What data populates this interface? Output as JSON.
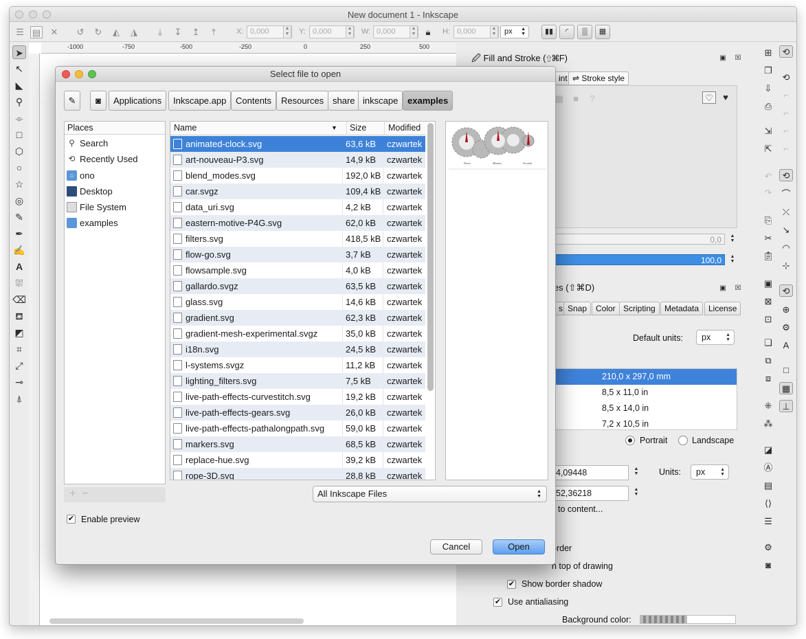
{
  "window": {
    "title": "New document 1 - Inkscape"
  },
  "toolbar": {
    "x_label": "X:",
    "x_value": "0,000",
    "y_label": "Y:",
    "y_value": "0,000",
    "w_label": "W:",
    "w_value": "0,000",
    "h_label": "H:",
    "h_value": "0,000",
    "units": "px"
  },
  "ruler": {
    "ticks": [
      "-1000",
      "-750",
      "-500",
      "-250",
      "0",
      "250",
      "500"
    ]
  },
  "fill_stroke": {
    "title": "Fill and Stroke (⇧⌘F)",
    "tabs": [
      "int",
      "Stroke style"
    ],
    "blur_value": "0,0",
    "opacity_value": "100,0"
  },
  "doc_props": {
    "title": "ies (⇧⌘D)",
    "tabs": [
      "s",
      "Snap",
      "Color",
      "Scripting",
      "Metadata",
      "License"
    ],
    "default_units_label": "Default units:",
    "default_units": "px",
    "paper_sizes": [
      "210,0 x 297,0 mm",
      "8,5 x 11,0 in",
      "8,5 x 14,0 in",
      "7,2 x 10,5 in"
    ],
    "portrait_label": "Portrait",
    "landscape_label": "Landscape",
    "width_value": "4,09448",
    "height_value": "52,36218",
    "units_label": "Units:",
    "units": "px",
    "resize_label": "to content...",
    "border_label": "order",
    "border_top_label": "n top of drawing",
    "border_shadow_label": "Show border shadow",
    "antialiasing_label": "Use antialiasing",
    "bg_color_label": "Background color:"
  },
  "dialog": {
    "title": "Select file to open",
    "path": [
      "Applications",
      "Inkscape.app",
      "Contents",
      "Resources",
      "share",
      "inkscape",
      "examples"
    ],
    "places_header": "Places",
    "places": [
      {
        "label": "Search",
        "icon": "search-icon"
      },
      {
        "label": "Recently Used",
        "icon": "clock-icon"
      },
      {
        "label": "ono",
        "icon": "home-folder-icon"
      },
      {
        "label": "Desktop",
        "icon": "desktop-icon"
      },
      {
        "label": "File System",
        "icon": "drive-icon"
      },
      {
        "label": "examples",
        "icon": "folder-icon"
      }
    ],
    "columns": {
      "name": "Name",
      "size": "Size",
      "modified": "Modified"
    },
    "files": [
      {
        "name": "animated-clock.svg",
        "size": "63,6 kB",
        "modified": "czwartek"
      },
      {
        "name": "art-nouveau-P3.svg",
        "size": "14,9 kB",
        "modified": "czwartek"
      },
      {
        "name": "blend_modes.svg",
        "size": "192,0 kB",
        "modified": "czwartek"
      },
      {
        "name": "car.svgz",
        "size": "109,4 kB",
        "modified": "czwartek"
      },
      {
        "name": "data_uri.svg",
        "size": "4,2 kB",
        "modified": "czwartek"
      },
      {
        "name": "eastern-motive-P4G.svg",
        "size": "62,0 kB",
        "modified": "czwartek"
      },
      {
        "name": "filters.svg",
        "size": "418,5 kB",
        "modified": "czwartek"
      },
      {
        "name": "flow-go.svg",
        "size": "3,7 kB",
        "modified": "czwartek"
      },
      {
        "name": "flowsample.svg",
        "size": "4,0 kB",
        "modified": "czwartek"
      },
      {
        "name": "gallardo.svgz",
        "size": "63,5 kB",
        "modified": "czwartek"
      },
      {
        "name": "glass.svg",
        "size": "14,6 kB",
        "modified": "czwartek"
      },
      {
        "name": "gradient.svg",
        "size": "62,3 kB",
        "modified": "czwartek"
      },
      {
        "name": "gradient-mesh-experimental.svgz",
        "size": "35,0 kB",
        "modified": "czwartek"
      },
      {
        "name": "i18n.svg",
        "size": "24,5 kB",
        "modified": "czwartek"
      },
      {
        "name": "l-systems.svgz",
        "size": "11,2 kB",
        "modified": "czwartek"
      },
      {
        "name": "lighting_filters.svg",
        "size": "7,5 kB",
        "modified": "czwartek"
      },
      {
        "name": "live-path-effects-curvestitch.svg",
        "size": "19,2 kB",
        "modified": "czwartek"
      },
      {
        "name": "live-path-effects-gears.svg",
        "size": "26,0 kB",
        "modified": "czwartek"
      },
      {
        "name": "live-path-effects-pathalongpath.svg",
        "size": "59,0 kB",
        "modified": "czwartek"
      },
      {
        "name": "markers.svg",
        "size": "68,5 kB",
        "modified": "czwartek"
      },
      {
        "name": "replace-hue.svg",
        "size": "39,2 kB",
        "modified": "czwartek"
      },
      {
        "name": "rope-3D.svg",
        "size": "28,8 kB",
        "modified": "czwartek"
      }
    ],
    "preview_labels": [
      "Hours",
      "Minutes",
      "Seconds"
    ],
    "filter": "All Inkscape Files",
    "enable_preview": "Enable preview",
    "cancel": "Cancel",
    "open": "Open"
  },
  "colors": {
    "selection": "#3d82d8",
    "accent": "#3d8ee4"
  }
}
